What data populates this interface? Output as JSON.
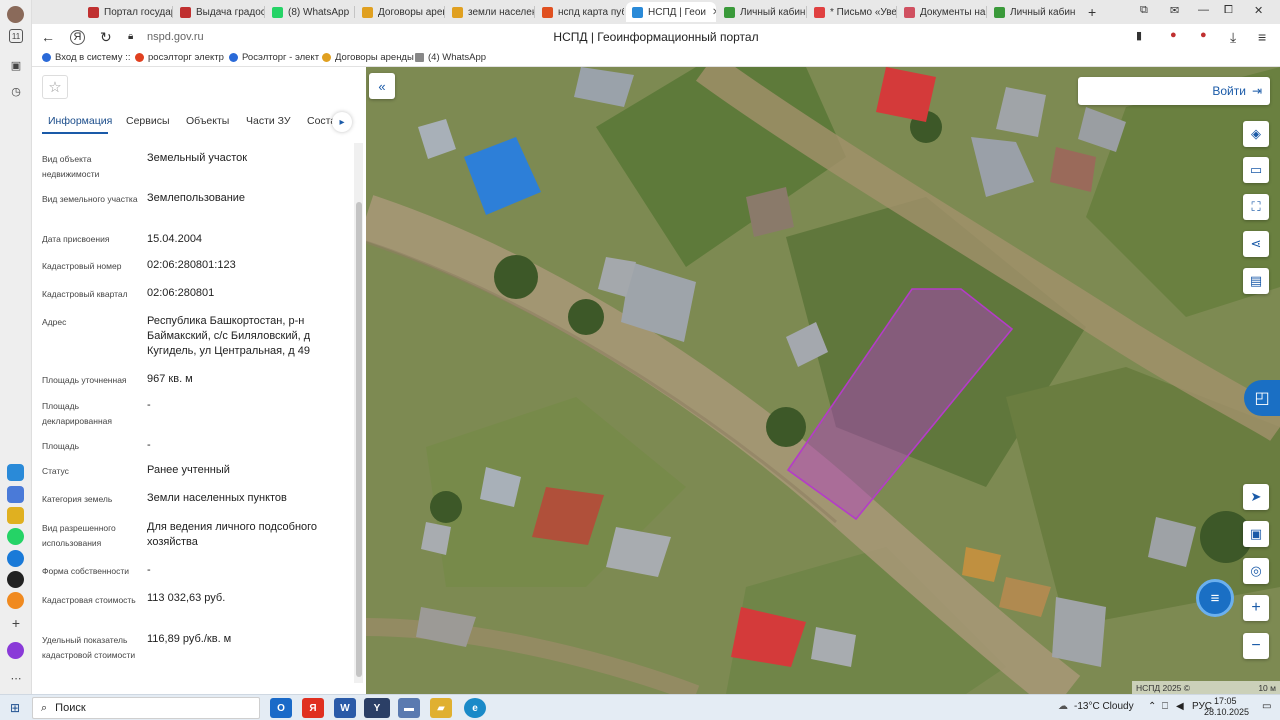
{
  "browser": {
    "tabs": [
      {
        "title": "Портал государ",
        "color": "#c03030"
      },
      {
        "title": "Выдача градос",
        "color": "#c03030"
      },
      {
        "title": "(8) WhatsApp",
        "color": "#25d366"
      },
      {
        "title": "Договоры арен",
        "color": "#e0a020"
      },
      {
        "title": "земли населен",
        "color": "#e0a020"
      },
      {
        "title": "нспд карта пуб",
        "color": "#e05020"
      },
      {
        "title": "НСПД | Геои",
        "color": "#2a8ad8"
      },
      {
        "title": "Личный кабин",
        "color": "#3a9a3a"
      },
      {
        "title": "* Письмо «Уве",
        "color": "#e04040"
      },
      {
        "title": "Документы на",
        "color": "#d05060"
      },
      {
        "title": "Личный кабин",
        "color": "#3a9a3a"
      }
    ],
    "active_tab_close": "✕",
    "new_tab": "+",
    "url": "nspd.gov.ru",
    "page_title": "НСПД | Геоинформационный портал",
    "bookmarks": [
      {
        "label": "Вход в систему ::",
        "color": "#2a6ad8"
      },
      {
        "label": "росэлторг электр",
        "color": "#e04020"
      },
      {
        "label": "Росэлторг - элект",
        "color": "#2a6ad8"
      },
      {
        "label": "Договоры аренды",
        "color": "#e0a020"
      },
      {
        "label": "(4) WhatsApp",
        "color": "#888888"
      }
    ]
  },
  "panel": {
    "star": "☆",
    "tabs": [
      "Информация",
      "Сервисы",
      "Объекты",
      "Части ЗУ",
      "Соста"
    ],
    "more": "▸",
    "fields": [
      {
        "label": "Вид объекта недвижимости",
        "value": "Земельный участок"
      },
      {
        "label": "Вид земельного участка",
        "value": "Землепользование"
      },
      {
        "label": "Дата присвоения",
        "value": "15.04.2004"
      },
      {
        "label": "Кадастровый номер",
        "value": "02:06:280801:123"
      },
      {
        "label": "Кадастровый квартал",
        "value": "02:06:280801"
      },
      {
        "label": "Адрес",
        "value": "Республика Башкортостан, р-н Баймакский, с/с Биляловский, д Кугидель, ул Центральная, д 49"
      },
      {
        "label": "Площадь уточненная",
        "value": "967 кв. м"
      },
      {
        "label": "Площадь декларированная",
        "value": "-"
      },
      {
        "label": "Площадь",
        "value": "-"
      },
      {
        "label": "Статус",
        "value": "Ранее учтенный"
      },
      {
        "label": "Категория земель",
        "value": "Земли населенных пунктов"
      },
      {
        "label": "Вид разрешенного использования",
        "value": "Для ведения личного подсобного хозяйства"
      },
      {
        "label": "Форма собственности",
        "value": "-"
      },
      {
        "label": "Кадастровая стоимость",
        "value": "113 032,63 руб."
      },
      {
        "label": "Удельный показатель кадастровой стоимости",
        "value": "116,89 руб./кв. м"
      }
    ]
  },
  "map": {
    "collapse": "«",
    "login": "Войти",
    "login_icon": "⇥",
    "tools": [
      "layers-icon",
      "ruler-icon",
      "select-area-icon",
      "share-icon",
      "print-icon",
      "locate-icon",
      "minimap-icon",
      "geo-search-icon",
      "zoom-in-icon",
      "zoom-out-icon"
    ],
    "zoom_in": "+",
    "zoom_out": "−",
    "attribution": "НСПД 2025 ©",
    "scale": "10 м",
    "parcel_color": "#b43cc8"
  },
  "taskbar": {
    "search": "Поиск",
    "weather": "-13°C Cloudy",
    "lang": "РУС",
    "time": "17:05",
    "date": "28.10.2025"
  }
}
